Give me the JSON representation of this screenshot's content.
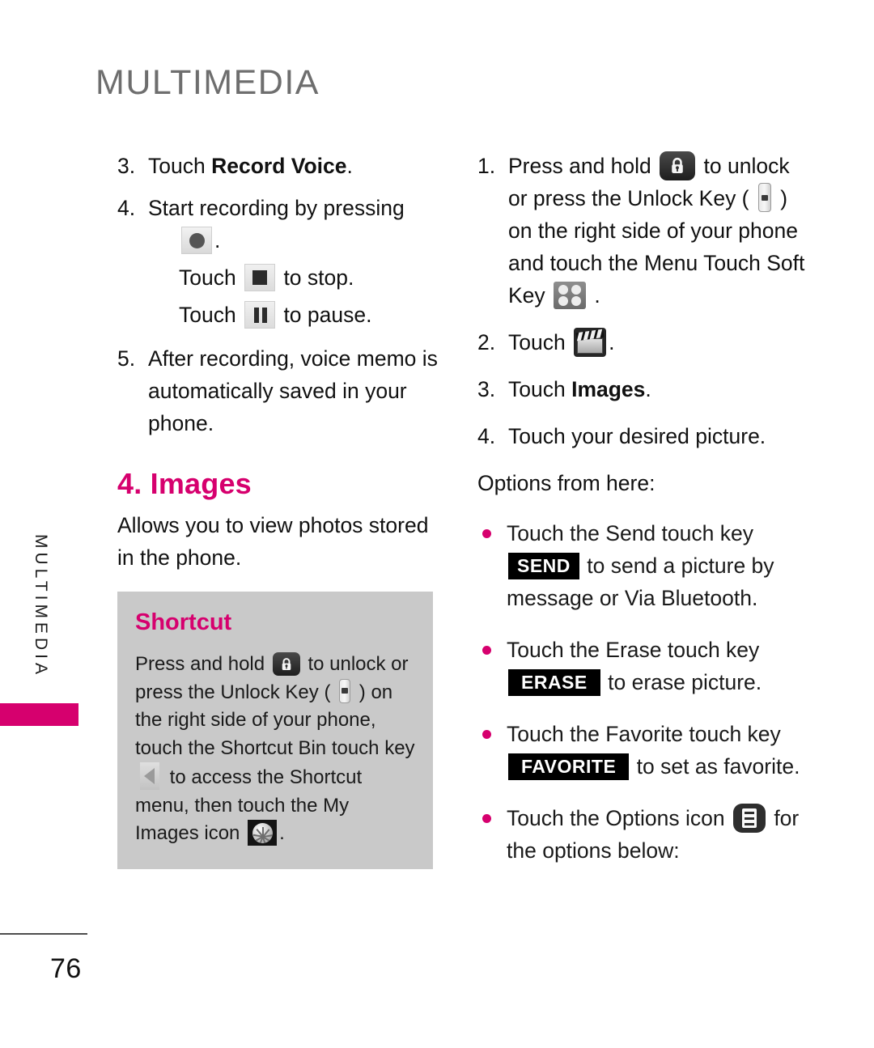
{
  "chapter": {
    "title": "MULTIMEDIA",
    "side_tab_label": "MULTIMEDIA",
    "accent_color": "#d6006e"
  },
  "footer": {
    "page_number": "76"
  },
  "left_column": {
    "step3": {
      "num": "3.",
      "text_before": "Touch ",
      "bold": "Record Voice",
      "text_after": "."
    },
    "step4": {
      "num": "4.",
      "line1": "Start recording by pressing",
      "record_icon": "record-icon",
      "period": ".",
      "stop_line_before": "Touch ",
      "stop_icon": "stop-icon",
      "stop_line_after": " to stop.",
      "pause_line_before": "Touch ",
      "pause_icon": "pause-icon",
      "pause_line_after": " to pause."
    },
    "step5": {
      "num": "5.",
      "text": "After recording, voice memo is automatically saved in your phone."
    },
    "section_heading": "4. Images",
    "section_intro": "Allows you to view photos stored in the phone.",
    "shortcut": {
      "title": "Shortcut",
      "s1": "Press and hold ",
      "lock_icon": "lock-icon",
      "s2": " to unlock or press the Unlock Key ( ",
      "unlock_key_icon": "unlock-key-icon",
      "s3": " ) on the right side of your phone, touch the Shortcut Bin touch key ",
      "arrow_icon": "shortcut-bin-arrow-icon",
      "s4": " to access the Shortcut menu, then touch the My Images icon ",
      "myimages_icon": "my-images-icon",
      "s5": "."
    }
  },
  "right_column": {
    "step1": {
      "num": "1.",
      "s1": "Press and hold ",
      "lock_icon": "lock-icon",
      "s2": " to unlock or press the Unlock Key ( ",
      "unlock_key_icon": "unlock-key-icon",
      "s3": " ) on the right side of your phone and touch the Menu Touch Soft Key ",
      "menu_key_icon": "menu-soft-key-icon",
      "s4": " ."
    },
    "step2": {
      "num": "2.",
      "text_before": "Touch ",
      "clapper_icon": "clapperboard-icon",
      "text_after": "."
    },
    "step3": {
      "num": "3.",
      "text_before": "Touch ",
      "bold": "Images",
      "text_after": "."
    },
    "step4": {
      "num": "4.",
      "text": "Touch your desired picture."
    },
    "options_lead": "Options from here:",
    "bullets": [
      {
        "before": "Touch the Send touch key",
        "chip": "SEND",
        "after": " to send a picture by message or Via Bluetooth."
      },
      {
        "before": "Touch the Erase touch key",
        "chip": "ERASE",
        "after": " to erase picture."
      },
      {
        "before": "Touch the Favorite touch key",
        "chip": "FAVORITE",
        "after": " to set as favorite."
      },
      {
        "before": "Touch the Options icon ",
        "icon": "options-icon",
        "after": " for the options below:"
      }
    ]
  }
}
